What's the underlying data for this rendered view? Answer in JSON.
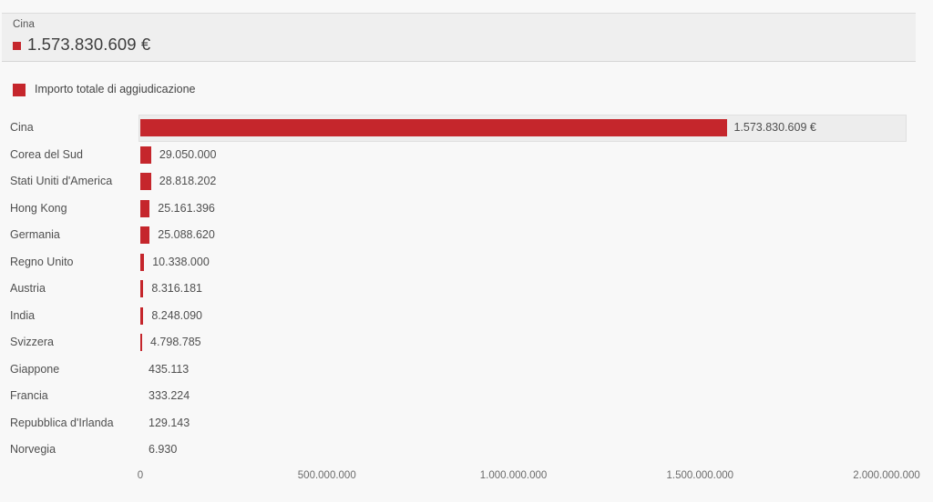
{
  "tooltip": {
    "title": "Cina",
    "value": "1.573.830.609 €",
    "marker_color": "#c5262c"
  },
  "legend": {
    "label": "Importo totale di aggiudicazione",
    "color": "#c5262c"
  },
  "chart_data": {
    "type": "bar",
    "orientation": "horizontal",
    "title": "",
    "xlabel": "",
    "ylabel": "",
    "grid": false,
    "legend_position": "top-left",
    "xlim": [
      0,
      2000000000
    ],
    "xticks": [
      "0",
      "500.000.000",
      "1.000.000.000",
      "1.500.000.000",
      "2.000.000.000"
    ],
    "xtick_values": [
      0,
      500000000,
      1000000000,
      1500000000,
      2000000000
    ],
    "series_name": "Importo totale di aggiudicazione",
    "color": "#c5262c",
    "highlighted_category": "Cina",
    "categories": [
      "Cina",
      "Corea del Sud",
      "Stati Uniti d'America",
      "Hong Kong",
      "Germania",
      "Regno Unito",
      "Austria",
      "India",
      "Svizzera",
      "Giappone",
      "Francia",
      "Repubblica d'Irlanda",
      "Norvegia"
    ],
    "values": [
      1573830609,
      29050000,
      28818202,
      25161396,
      25088620,
      10338000,
      8316181,
      8248090,
      4798785,
      435113,
      333224,
      129143,
      6930
    ],
    "value_labels": [
      "1.573.830.609 €",
      "29.050.000",
      "28.818.202",
      "25.161.396",
      "25.088.620",
      "10.338.000",
      "8.316.181",
      "8.248.090",
      "4.798.785",
      "435.113",
      "333.224",
      "129.143",
      "6.930"
    ]
  }
}
